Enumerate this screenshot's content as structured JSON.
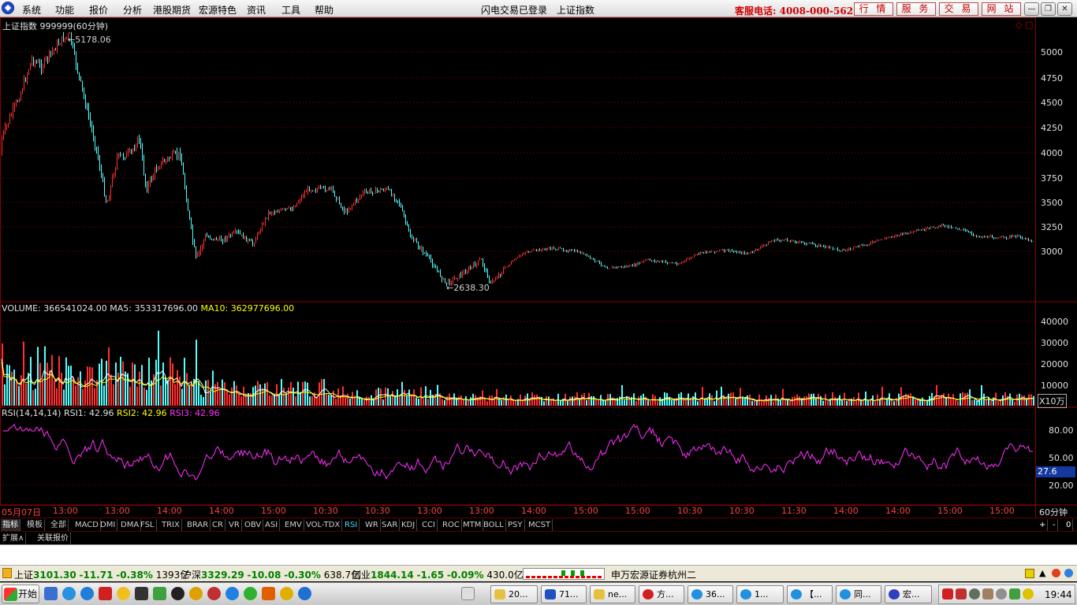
{
  "menu": {
    "items": [
      "系统",
      "功能",
      "报价",
      "分析",
      "港股期货",
      "宏源特色",
      "资讯",
      "工具",
      "帮助"
    ],
    "login_status": "闪电交易已登录",
    "current_index": "上证指数",
    "hotline": "客服电话: 4008-000-562",
    "buttons": [
      "行 情",
      "服 务",
      "交 易",
      "网 站"
    ]
  },
  "chart": {
    "title": "上证指数 999999(60分钟)",
    "high_label": "5178.06",
    "low_label": "2638.30",
    "price_axis": [
      "5000",
      "4750",
      "4500",
      "4250",
      "4000",
      "3750",
      "3500",
      "3250",
      "3000"
    ],
    "volume": {
      "label": "VOLUME:",
      "value": "366541024.00",
      "ma5_label": "MA5:",
      "ma5": "353317696.00",
      "ma10_label": "MA10:",
      "ma10": "362977696.00",
      "axis": [
        "40000",
        "30000",
        "20000",
        "10000"
      ],
      "unit": "X10万"
    },
    "rsi": {
      "label": "RSI(14,14,14)",
      "rsi1_label": "RSI1:",
      "rsi1": "42.96",
      "rsi2_label": "RSI2:",
      "rsi2": "42.96",
      "rsi3_label": "RSI3:",
      "rsi3": "42.96",
      "axis": [
        "80.00",
        "50.00",
        "20.00"
      ],
      "current": "27.6"
    },
    "time_axis": [
      "05月07日",
      "13:00",
      "13:00",
      "14:00",
      "14:00",
      "15:00",
      "10:30",
      "10:30",
      "13:00",
      "13:00",
      "14:00",
      "15:00",
      "15:00",
      "10:30",
      "10:30",
      "11:30",
      "14:00",
      "14:00",
      "15:00",
      "15:00"
    ],
    "period": "60分钟",
    "colors": {
      "up": "#ff3030",
      "down": "#54ffff",
      "ma5": "#ffffff",
      "ma10": "#ffff00",
      "rsi": "#ff30ff",
      "grid": "#8a0000"
    }
  },
  "tabs": [
    "指标",
    "模板",
    "全部",
    "MACD",
    "DMI",
    "DMA",
    "FSL",
    "TRIX",
    "BRAR",
    "CR",
    "VR",
    "OBV",
    "ASI",
    "EMV",
    "VOL-TDX",
    "RSI",
    "WR",
    "SAR",
    "KDJ",
    "CCI",
    "ROC",
    "MTM",
    "BOLL",
    "PSY",
    "MCST"
  ],
  "tab_controls": [
    "+",
    "-",
    "0"
  ],
  "subtabs": [
    "扩展∧",
    "关联报价"
  ],
  "status": {
    "sh": {
      "name": "上证",
      "price": "3101.30",
      "chg": "-11.71",
      "pct": "-0.38%",
      "amt": "1393亿"
    },
    "hs": {
      "name": "沪深",
      "price": "3329.29",
      "chg": "-10.08",
      "pct": "-0.30%",
      "amt": "638.7亿"
    },
    "cy": {
      "name": "创业",
      "price": "1844.14",
      "chg": "-1.65",
      "pct": "-0.09%",
      "amt": "430.0亿"
    },
    "broker": "申万宏源证券杭州二"
  },
  "taskbar": {
    "start": "开始",
    "tasks": [
      "20...",
      "71...",
      "ne...",
      "方...",
      "36...",
      "1...",
      "【...",
      "同...",
      "宏..."
    ],
    "clock": "19:44"
  }
}
